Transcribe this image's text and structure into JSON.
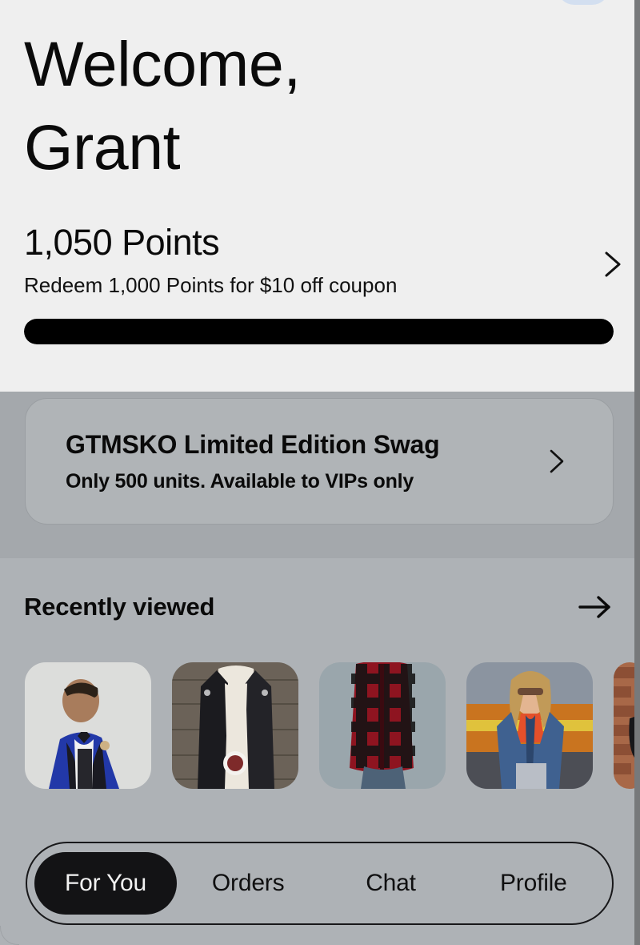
{
  "header": {
    "greeting": "Welcome, Grant",
    "notification_pill": "notification-indicator"
  },
  "points": {
    "value_label": "1,050 Points",
    "redeem_label": "Redeem 1,000 Points for $10 off coupon",
    "chevron_icon": "chevron-right-icon",
    "progress_percent": 100
  },
  "promo": {
    "title": "GTMSKO Limited Edition Swag",
    "subtitle": "Only 500 units. Available to VIPs only",
    "chevron_icon": "chevron-right-icon"
  },
  "recently_viewed": {
    "title": "Recently viewed",
    "arrow_icon": "arrow-right-icon",
    "items": [
      {
        "alt": "Man in blue patterned tuxedo jacket with bow tie"
      },
      {
        "alt": "Person in black quilted leather jacket holding mug"
      },
      {
        "alt": "Man in red and black buffalo plaid flannel shirt"
      },
      {
        "alt": "Woman in blue denim jacket with orange crop top"
      },
      {
        "alt": "Black bag against a brick wall"
      }
    ]
  },
  "bottom_nav": {
    "items": [
      {
        "label": "For You",
        "active": true
      },
      {
        "label": "Orders",
        "active": false
      },
      {
        "label": "Chat",
        "active": false
      },
      {
        "label": "Profile",
        "active": false
      }
    ]
  },
  "colors": {
    "header_bg": "#efefef",
    "dim_overlay": "#a4a8ac",
    "accent_dark": "#000000",
    "notification_blue": "#d3dff0"
  }
}
